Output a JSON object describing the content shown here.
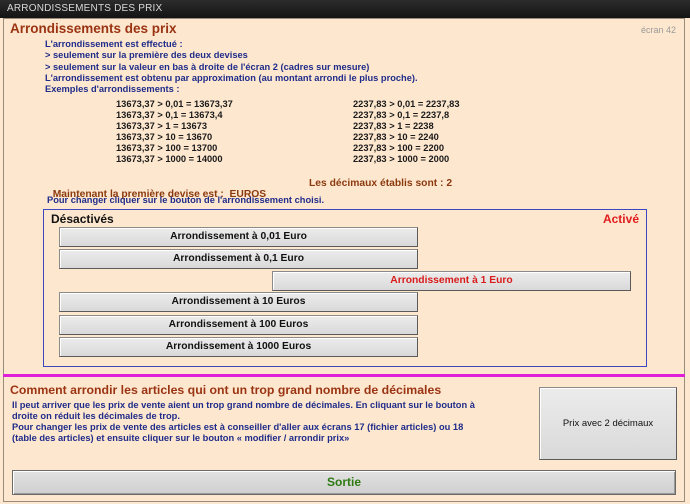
{
  "window": {
    "title": "ARRONDISSEMENTS DES PRIX"
  },
  "header": {
    "title": "Arrondissements des prix",
    "screen_number": "écran 42"
  },
  "intro_lines": [
    "L'arrondissement est effectué :",
    "> seulement sur la première des deux devises",
    "> seulement sur la valeur en bas à droite de l'écran 2 (cadres sur mesure)",
    "L'arrondissement est obtenu par approximation (au montant arrondi le plus proche).",
    "Exemples d'arrondissements :"
  ],
  "examples_left": [
    "13673,37 > 0,01 = 13673,37",
    "13673,37 > 0,1 = 13673,4",
    "13673,37 > 1 = 13673",
    "13673,37 > 10  = 13670",
    "13673,37 > 100 = 13700",
    "13673,37 > 1000 = 14000"
  ],
  "examples_right": [
    "2237,83 > 0,01 = 2237,83",
    "2237,83 > 0,1 = 2237,8",
    "2237,83 > 1 = 2238",
    "2237,83 > 10  = 2240",
    "2237,83 > 100  = 2200",
    "2237,83 > 1000  = 2000"
  ],
  "currency": {
    "text": "Maintenant la première devise est :  EUROS",
    "decimals_text": "Les décimaux établis sont : 2"
  },
  "instruction": "Pour changer cliquer sur le bouton de l'arrondissement choisi.",
  "panel": {
    "deactivated_label": "Désactivés",
    "activated_label": "Activé",
    "buttons": [
      {
        "label": "Arrondissement à  0,01 Euro",
        "active": false
      },
      {
        "label": "Arrondissement à  0,1 Euro",
        "active": false
      },
      {
        "label": "Arrondissement à 1 Euro",
        "active": true
      },
      {
        "label": "Arrondissement à 10 Euros",
        "active": false
      },
      {
        "label": "Arrondissement à 100 Euros",
        "active": false
      },
      {
        "label": "Arrondissement à 1000 Euros",
        "active": false
      }
    ]
  },
  "decimals_section": {
    "title": "Comment arrondir les articles qui ont un trop grand nombre de décimales",
    "help_lines": [
      "Il peut arriver que les prix de vente aient un trop grand nombre de décimales. En cliquant sur le bouton à",
      "droite on réduit les décimales de trop.",
      "Pour changer les prix de vente des articles est à conseiller d'aller aux écrans 17 (fichier articles) ou 18",
      "(table des articles) et ensuite cliquer sur le bouton « modifier / arrondir prix»"
    ],
    "button_label": "Prix avec 2 décimaux"
  },
  "exit_label": "Sortie",
  "colors": {
    "background": "#fde7cf",
    "heading": "#9a3412",
    "body_text": "#1f2c8a",
    "active_text": "#d81b1b",
    "divider": "#e020d8",
    "exit_text": "#2d7a12"
  }
}
